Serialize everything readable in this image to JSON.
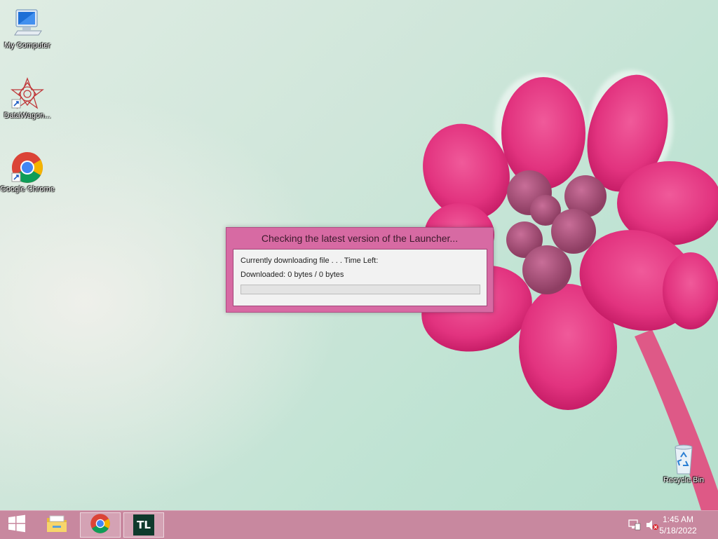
{
  "desktop": {
    "icons": [
      {
        "label": "My Computer"
      },
      {
        "label": "DataWagon..."
      },
      {
        "label": "Google Chrome"
      },
      {
        "label": "Recycle Bin"
      }
    ]
  },
  "dialog": {
    "title": "Checking the latest version of the Launcher...",
    "status_line": "Currently downloading file . . . Time Left:",
    "downloaded_line": "Downloaded: 0 bytes / 0 bytes",
    "progress_percent": 0
  },
  "taskbar": {
    "items": [
      {
        "icon": "windows-start-icon"
      },
      {
        "icon": "file-explorer-icon"
      },
      {
        "icon": "chrome-icon"
      },
      {
        "icon": "tl-launcher-icon",
        "text": "TL"
      }
    ],
    "tray": {
      "network_icon": "network-icon",
      "volume_icon": "volume-muted-icon",
      "time": "1:45 AM",
      "date": "5/18/2022"
    }
  },
  "colors": {
    "dialog_frame": "#d76aa3",
    "taskbar": "#c8889f",
    "flower": "#e2337f"
  }
}
